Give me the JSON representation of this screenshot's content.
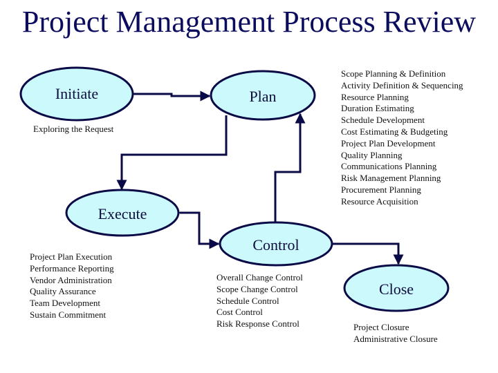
{
  "title": "Project Management Process Review",
  "colors": {
    "title": "#0c0c5e",
    "node_fill": "#ccfafc",
    "node_stroke": "#0a0a46",
    "connector": "#0a0a46",
    "text": "#111111"
  },
  "nodes": {
    "initiate": {
      "label": "Initiate"
    },
    "plan": {
      "label": "Plan"
    },
    "execute": {
      "label": "Execute"
    },
    "control": {
      "label": "Control"
    },
    "close": {
      "label": "Close"
    }
  },
  "initiate_caption": "Exploring the Request",
  "plan_items": [
    "Scope Planning & Definition",
    "Activity Definition & Sequencing",
    "Resource Planning",
    "Duration Estimating",
    "Schedule Development",
    "Cost Estimating & Budgeting",
    "Project Plan Development",
    "Quality Planning",
    "Communications Planning",
    "Risk Management Planning",
    "Procurement Planning",
    "Resource Acquisition"
  ],
  "execute_items": [
    "Project Plan Execution",
    "Performance Reporting",
    "Vendor Administration",
    "Quality Assurance",
    "Team Development",
    "Sustain Commitment"
  ],
  "control_items": [
    "Overall Change Control",
    "Scope Change Control",
    "Schedule Control",
    "Cost Control",
    "Risk Response Control"
  ],
  "close_items": [
    "Project Closure",
    "Administrative Closure"
  ],
  "connections": [
    {
      "from": "initiate",
      "to": "plan"
    },
    {
      "from": "plan",
      "to": "execute"
    },
    {
      "from": "execute",
      "to": "control",
      "bidirectional": true
    },
    {
      "from": "control",
      "to": "plan"
    },
    {
      "from": "control",
      "to": "close"
    }
  ]
}
